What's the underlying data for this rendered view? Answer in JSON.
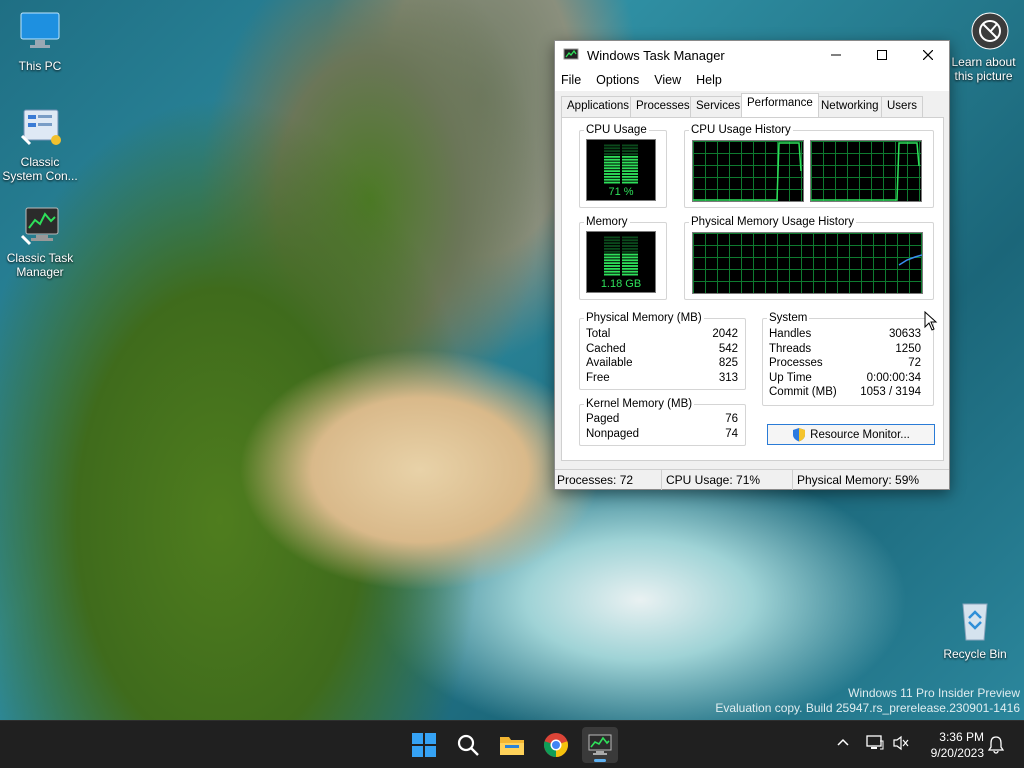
{
  "desktop": {
    "icons": [
      {
        "label": "This PC"
      },
      {
        "label": "Classic System Con..."
      },
      {
        "label": "Classic Task Manager"
      },
      {
        "label": "Recycle Bin"
      }
    ],
    "learn_about": "Learn about this picture",
    "watermark": {
      "line1": "Windows 11 Pro Insider Preview",
      "line2": "Evaluation copy. Build 25947.rs_prerelease.230901-1416"
    }
  },
  "taskbar": {
    "time": "3:36 PM",
    "date": "9/20/2023",
    "apps": [
      "windows-start",
      "search",
      "file-explorer",
      "chrome",
      "classic-task-manager"
    ]
  },
  "taskmgr": {
    "title": "Windows Task Manager",
    "menu": [
      "File",
      "Options",
      "View",
      "Help"
    ],
    "tabs": [
      "Applications",
      "Processes",
      "Services",
      "Performance",
      "Networking",
      "Users"
    ],
    "active_tab": "Performance",
    "cpu_usage": {
      "label": "CPU Usage",
      "value": "71 %",
      "level": 0.71
    },
    "cpu_history": {
      "label": "CPU Usage History"
    },
    "memory": {
      "label": "Memory",
      "value": "1.18 GB",
      "level": 0.59
    },
    "memory_history": {
      "label": "Physical Memory Usage History"
    },
    "physical_memory": {
      "label": "Physical Memory (MB)",
      "rows": [
        {
          "k": "Total",
          "v": "2042"
        },
        {
          "k": "Cached",
          "v": "542"
        },
        {
          "k": "Available",
          "v": "825"
        },
        {
          "k": "Free",
          "v": "313"
        }
      ]
    },
    "kernel_memory": {
      "label": "Kernel Memory (MB)",
      "rows": [
        {
          "k": "Paged",
          "v": "76"
        },
        {
          "k": "Nonpaged",
          "v": "74"
        }
      ]
    },
    "system": {
      "label": "System",
      "rows": [
        {
          "k": "Handles",
          "v": "30633"
        },
        {
          "k": "Threads",
          "v": "1250"
        },
        {
          "k": "Processes",
          "v": "72"
        },
        {
          "k": "Up Time",
          "v": "0:00:00:34"
        },
        {
          "k": "Commit (MB)",
          "v": "1053 / 3194"
        }
      ]
    },
    "resource_monitor": "Resource Monitor...",
    "status": {
      "processes": "Processes: 72",
      "cpu": "CPU Usage: 71%",
      "memory": "Physical Memory: 59%"
    }
  }
}
